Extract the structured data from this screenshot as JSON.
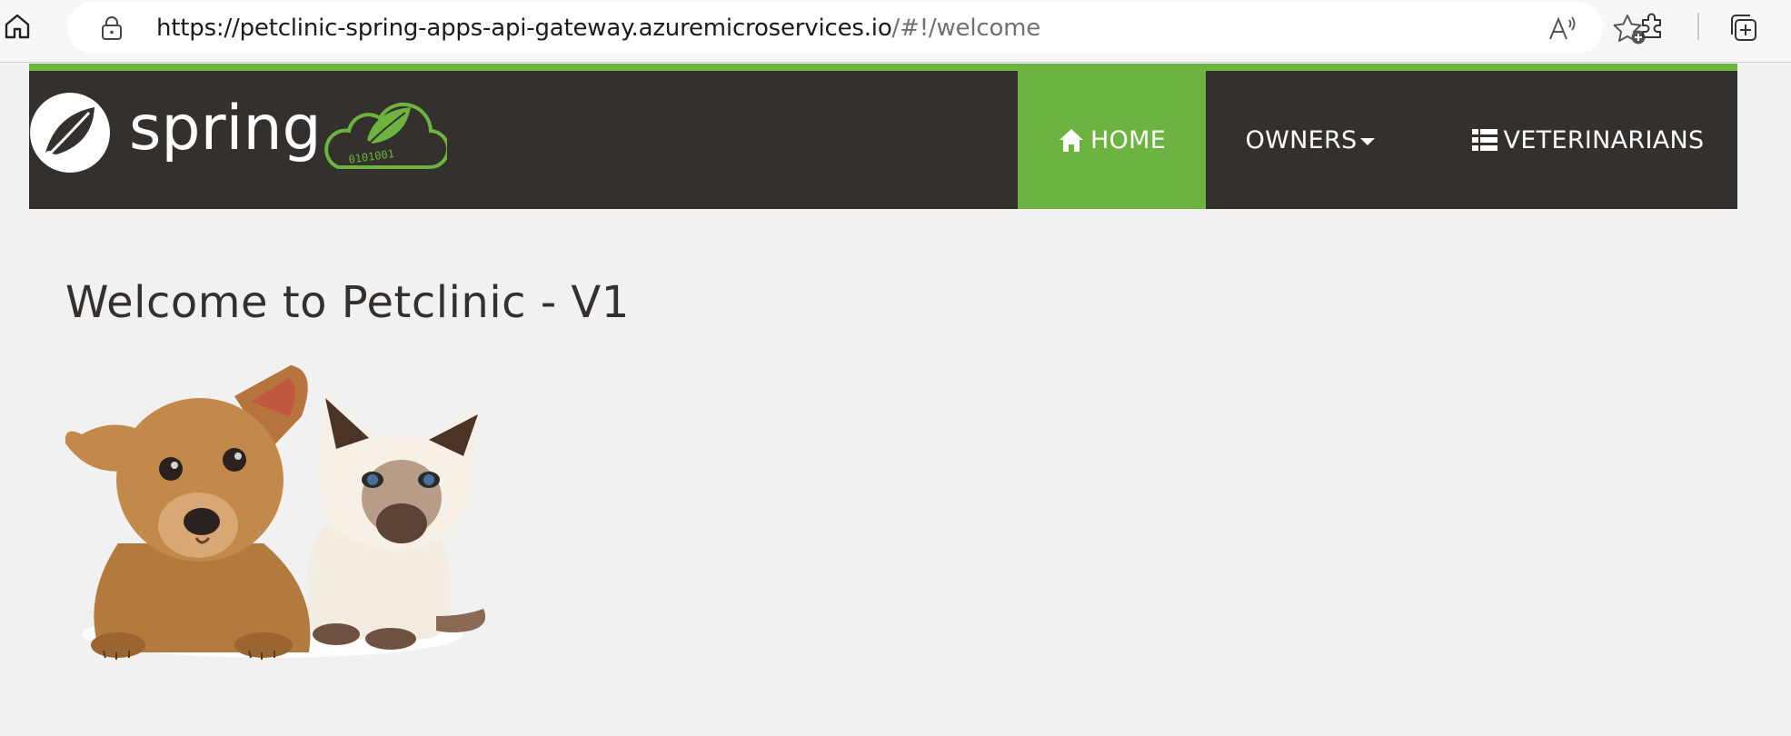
{
  "browser": {
    "url_host": "https://petclinic-spring-apps-api-gateway.azuremicroservices.io",
    "url_path": "/#!/welcome"
  },
  "navbar": {
    "logo_text": "spring",
    "items": [
      {
        "label": "HOME",
        "icon": "home-icon",
        "active": true
      },
      {
        "label": "OWNERS",
        "icon": "chevron-down-icon",
        "active": false
      },
      {
        "label": "VETERINARIANS",
        "icon": "list-icon",
        "active": false
      }
    ]
  },
  "main": {
    "title": "Welcome to Petclinic - V1",
    "image_alt": "puppy-and-kitten-image"
  },
  "colors": {
    "accent": "#6db33f",
    "navbar_bg": "#34302d",
    "page_bg": "#f1f1f1"
  }
}
